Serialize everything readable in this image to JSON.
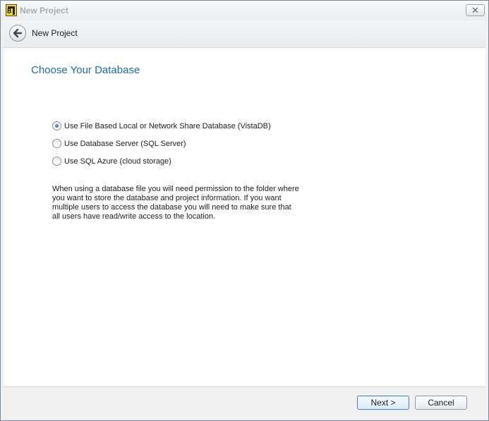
{
  "window": {
    "title": "New Project",
    "close_glyph": "✕",
    "app_icon_text": "8"
  },
  "nav": {
    "back_icon": "back-arrow-icon",
    "title": "New Project"
  },
  "page": {
    "heading": "Choose Your Database",
    "options": [
      {
        "label": "Use File Based Local or Network Share Database (VistaDB)",
        "checked": true
      },
      {
        "label": "Use Database Server (SQL Server)",
        "checked": false
      },
      {
        "label": "Use SQL Azure (cloud storage)",
        "checked": false
      }
    ],
    "info_lines": [
      "When using a database file you will need permission to the folder where",
      "you want to store the database and project information. If you want",
      "multiple users to access the database you will need to make sure that",
      "all users have read/write access to the location."
    ]
  },
  "footer": {
    "next_label": "Next >",
    "cancel_label": "Cancel"
  },
  "colors": {
    "heading": "#1f6aa8",
    "title_text": "#a7acb2",
    "radio_checked": "#2b5c99"
  }
}
